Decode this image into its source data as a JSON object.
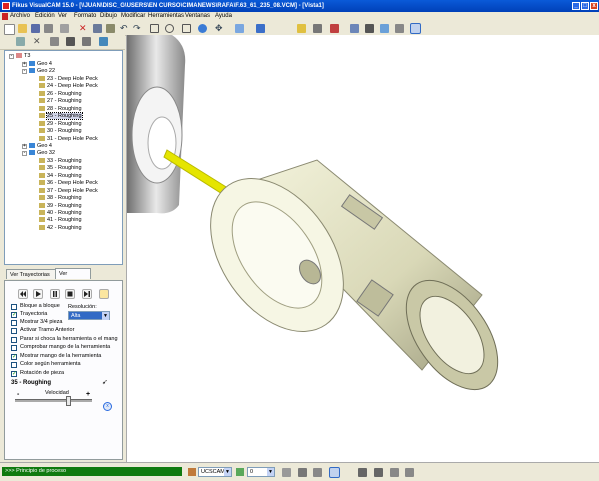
{
  "window": {
    "title": "Fikus VisualCAM 15.0 - [\\\\JUAN\\DISC_G\\USERS\\EN CURSO\\CIMANEWS\\RAFA\\F.63_61_235_08.VCM] - [Vista1]",
    "minimize": "_",
    "maximize": "□",
    "close": "x"
  },
  "menu": [
    "Archivo",
    "Edición",
    "Ver",
    "Formato",
    "Dibujo",
    "Modificar",
    "Herramientas",
    "Ventanas",
    "Ayuda"
  ],
  "tree": {
    "root": "T3",
    "nodes": [
      {
        "label": "Geo 4",
        "type": "geo"
      },
      {
        "label": "Geo 22",
        "type": "geo-open"
      },
      {
        "label": "23 - Deep Hole Peck",
        "type": "op"
      },
      {
        "label": "24 - Deep Hole Peck",
        "type": "op"
      },
      {
        "label": "26 - Roughing",
        "type": "op"
      },
      {
        "label": "27 - Roughing",
        "type": "op"
      },
      {
        "label": "28 - Roughing",
        "type": "op"
      },
      {
        "label": "25 - Roughing",
        "type": "op",
        "selected": true
      },
      {
        "label": "29 - Roughing",
        "type": "op"
      },
      {
        "label": "30 - Roughing",
        "type": "op"
      },
      {
        "label": "31 - Deep Hole Peck",
        "type": "op"
      },
      {
        "label": "Geo 4",
        "type": "geo"
      },
      {
        "label": "Geo 32",
        "type": "geo-open"
      },
      {
        "label": "33 - Roughing",
        "type": "op"
      },
      {
        "label": "35 - Roughing",
        "type": "op"
      },
      {
        "label": "34 - Roughing",
        "type": "op"
      },
      {
        "label": "36 - Deep Hole Peck",
        "type": "op"
      },
      {
        "label": "37 - Deep Hole Peck",
        "type": "op"
      },
      {
        "label": "38 - Roughing",
        "type": "op"
      },
      {
        "label": "39 - Roughing",
        "type": "op"
      },
      {
        "label": "40 - Roughing",
        "type": "op"
      },
      {
        "label": "41 - Roughing",
        "type": "op"
      },
      {
        "label": "42 - Roughing",
        "type": "op"
      }
    ]
  },
  "tabs": {
    "trayectorias": "Ver Trayectorias",
    "material": "Ver Material"
  },
  "sim": {
    "resolucion_label": "Resolución:",
    "resolucion_value": "Alta",
    "options": [
      {
        "label": "Bloque a bloque",
        "checked": false
      },
      {
        "label": "Trayectoria",
        "checked": true
      },
      {
        "label": "Mostrar 3/4 pieza",
        "checked": false
      },
      {
        "label": "Activar Tramo Anterior",
        "checked": false
      },
      {
        "label": "Parar si choca la herramienta o el mang",
        "checked": false
      },
      {
        "label": "Comprobar mango de la herramienta",
        "checked": false
      },
      {
        "label": "Mostrar mango de la herramienta",
        "checked": true
      },
      {
        "label": "Color según herramienta",
        "checked": false
      },
      {
        "label": "Rotación de pieza",
        "checked": true
      }
    ],
    "current_op": "35 - Roughing",
    "velocidad_label": "Velocidad",
    "minus": "-",
    "plus": "+"
  },
  "status": {
    "message": ">>> Principio de proceso",
    "ucs": "UCSCAM",
    "layer": "0"
  },
  "colors": {
    "title_bar": "#0a5ad8",
    "status_msg": "#0f7a0f",
    "part": "#ecebc8",
    "tool": "#e5e500"
  }
}
